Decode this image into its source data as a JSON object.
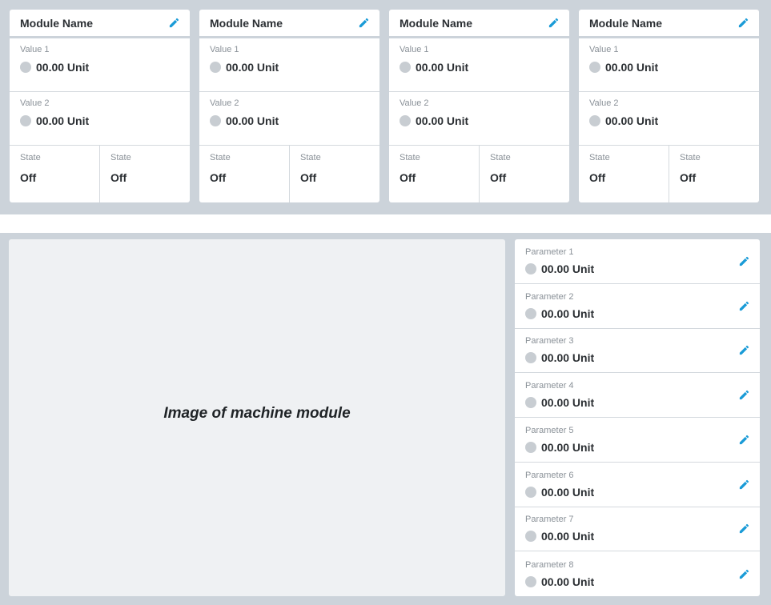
{
  "modules": [
    {
      "name": "Module Name",
      "value1_label": "Value 1",
      "value1": "00.00 Unit",
      "value2_label": "Value 2",
      "value2": "00.00 Unit",
      "state1_label": "State",
      "state1": "Off",
      "state2_label": "State",
      "state2": "Off"
    },
    {
      "name": "Module Name",
      "value1_label": "Value 1",
      "value1": "00.00 Unit",
      "value2_label": "Value 2",
      "value2": "00.00 Unit",
      "state1_label": "State",
      "state1": "Off",
      "state2_label": "State",
      "state2": "Off"
    },
    {
      "name": "Module Name",
      "value1_label": "Value 1",
      "value1": "00.00 Unit",
      "value2_label": "Value 2",
      "value2": "00.00 Unit",
      "state1_label": "State",
      "state1": "Off",
      "state2_label": "State",
      "state2": "Off"
    },
    {
      "name": "Module Name",
      "value1_label": "Value 1",
      "value1": "00.00 Unit",
      "value2_label": "Value 2",
      "value2": "00.00 Unit",
      "state1_label": "State",
      "state1": "Off",
      "state2_label": "State",
      "state2": "Off"
    }
  ],
  "image_placeholder": "Image of machine module",
  "parameters": [
    {
      "label": "Parameter 1",
      "value": "00.00 Unit"
    },
    {
      "label": "Parameter 2",
      "value": "00.00 Unit"
    },
    {
      "label": "Parameter 3",
      "value": "00.00 Unit"
    },
    {
      "label": "Parameter 4",
      "value": "00.00 Unit"
    },
    {
      "label": "Parameter 5",
      "value": "00.00 Unit"
    },
    {
      "label": "Parameter 6",
      "value": "00.00 Unit"
    },
    {
      "label": "Parameter 7",
      "value": "00.00 Unit"
    },
    {
      "label": "Parameter 8",
      "value": "00.00 Unit"
    }
  ],
  "icons": {
    "edit": "pencil-icon",
    "status": "status-dot-icon"
  },
  "colors": {
    "accent": "#1a9bd7",
    "panel_bg": "#ccd3da",
    "status_dot": "#c8cdd2",
    "image_bg": "#eff1f3"
  }
}
